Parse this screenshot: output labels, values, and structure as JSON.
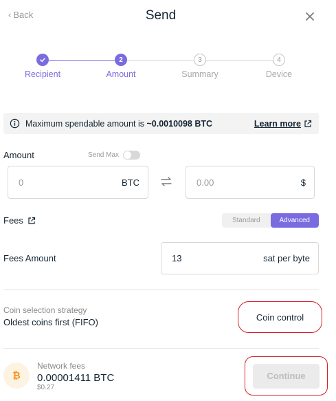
{
  "header": {
    "back_label": "Back",
    "title": "Send"
  },
  "stepper": {
    "steps": [
      {
        "label": "Recipient",
        "number": "1",
        "state": "done"
      },
      {
        "label": "Amount",
        "number": "2",
        "state": "active"
      },
      {
        "label": "Summary",
        "number": "3",
        "state": "todo"
      },
      {
        "label": "Device",
        "number": "4",
        "state": "todo"
      }
    ]
  },
  "banner": {
    "prefix": "Maximum spendable amount is ",
    "amount": "~0.0010098 BTC",
    "learn_more": "Learn more"
  },
  "amount": {
    "label": "Amount",
    "send_max_label": "Send Max",
    "send_max_enabled": false,
    "crypto_value": "0",
    "crypto_unit": "BTC",
    "fiat_value": "0.00",
    "fiat_unit": "$"
  },
  "fees": {
    "label": "Fees",
    "options": [
      "Standard",
      "Advanced"
    ],
    "selected": "Advanced",
    "amount_label": "Fees Amount",
    "amount_value": "13",
    "amount_unit": "sat per byte"
  },
  "coin_selection": {
    "label": "Coin selection strategy",
    "value": "Oldest coins first (FIFO)",
    "button": "Coin control"
  },
  "footer": {
    "network_fees_label": "Network fees",
    "network_fees_value": "0.00001411 BTC",
    "network_fees_fiat": "$0.27",
    "continue_label": "Continue"
  },
  "colors": {
    "accent": "#7a6be0",
    "highlight_outline": "#d21f26",
    "bitcoin": "#f7931a"
  }
}
